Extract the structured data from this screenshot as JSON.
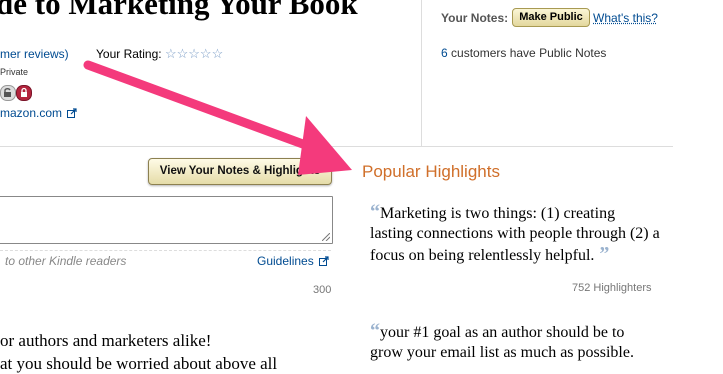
{
  "book": {
    "title_fragment": "de to Marketing Your Book"
  },
  "reviews": {
    "link_fragment": "mer reviews)"
  },
  "rating": {
    "label": "Your Rating:",
    "stars": "☆☆☆☆☆",
    "value": 0
  },
  "privacy": {
    "private_label": "Private"
  },
  "amazon": {
    "link_fragment": "mazon.com"
  },
  "notes": {
    "label": "Your Notes:",
    "make_public": "Make Public",
    "whats_this": "What's this?",
    "public_count": "6",
    "public_text": "customers have Public Notes"
  },
  "editor": {
    "view_button": "View Your Notes & Highlights",
    "hint": "to other Kindle readers",
    "guidelines": "Guidelines",
    "counter": "300"
  },
  "description": {
    "line1": "or authors and marketers alike!",
    "line2": "at you should be worried about above all"
  },
  "highlights": {
    "title": "Popular Highlights",
    "items": [
      {
        "text": "Marketing is two things: (1) creating lasting connections with people through (2) a focus on being relentlessly helpful.",
        "count": "752 Highlighters"
      },
      {
        "text": "your #1 goal as an author should be to grow your email list as much as possible."
      }
    ]
  },
  "annotation": {
    "arrow_color": "#f43a7c"
  }
}
